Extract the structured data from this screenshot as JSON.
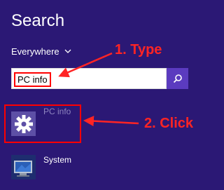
{
  "header": {
    "title": "Search"
  },
  "scope": {
    "label": "Everywhere"
  },
  "search": {
    "value": "PC info"
  },
  "results": [
    {
      "label": "PC info",
      "icon": "gear-icon"
    },
    {
      "label": "System",
      "icon": "system-monitor-icon"
    }
  ],
  "annotations": {
    "step1": "1. Type",
    "step2": "2. Click"
  },
  "colors": {
    "background": "#2b1875",
    "accent": "#5b3bbf",
    "annotation": "#ff2424"
  }
}
